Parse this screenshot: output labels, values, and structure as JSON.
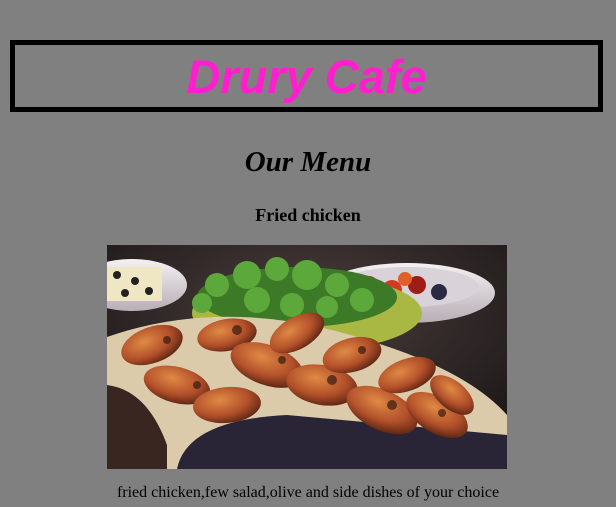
{
  "header": {
    "title": "Drury Cafe"
  },
  "menu": {
    "heading": "Our Menu",
    "items": [
      {
        "name": "Fried chicken",
        "image": "fried-chicken-photo",
        "description": "fried chicken,few salad,olive and side dishes of your choice"
      }
    ]
  },
  "colors": {
    "background": "#808080",
    "title": "#ff1fcf",
    "border": "#000000"
  }
}
